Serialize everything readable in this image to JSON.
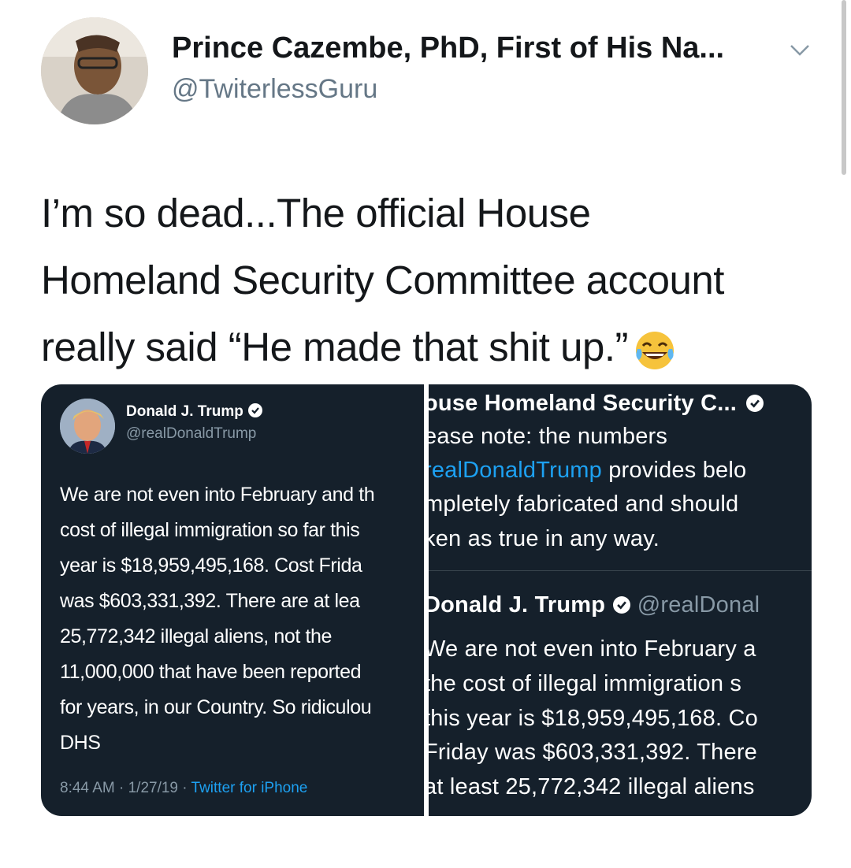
{
  "author": {
    "name": "Prince Cazembe, PhD, First of His Na...",
    "handle": "@TwiterlessGuru"
  },
  "tweet": {
    "line1": "I’m so dead...The official House",
    "line2": "Homeland Security Committee account",
    "line3": "really said “He made that shit up.”",
    "emoji": "face-with-tears-of-joy"
  },
  "embedded_left": {
    "name": "Donald J. Trump",
    "handle": "@realDonaldTrump",
    "text": "We are not even into February and th\ncost of illegal immigration so far this\nyear is $18,959,495,168. Cost Frida\nwas $603,331,392. There are at lea\n25,772,342 illegal aliens, not the\n11,000,000 that have been reported\nfor years, in our Country. So ridiculou\nDHS",
    "timestamp": "8:44 AM · 1/27/19 ·",
    "source": "Twitter for iPhone"
  },
  "embedded_right": {
    "name": "ouse Homeland Security C...",
    "line1": "ease note: the numbers",
    "line2_link": "realDonaldTrump",
    "line2_rest": " provides belo",
    "line3": "mpletely fabricated and should",
    "line4": "ken as true in any way.",
    "quoted_name": "Donald J. Trump",
    "quoted_handle": "@realDonal",
    "q1": "We are not even into February a",
    "q2": "the cost of illegal immigration s",
    "q3": "this year is $18,959,495,168. Co",
    "q4": "Friday was $603,331,392. There",
    "q5": "at least 25,772,342 illegal aliens"
  },
  "colors": {
    "panel_bg": "#15202b",
    "link": "#1da1f2",
    "muted": "#8899a6"
  }
}
